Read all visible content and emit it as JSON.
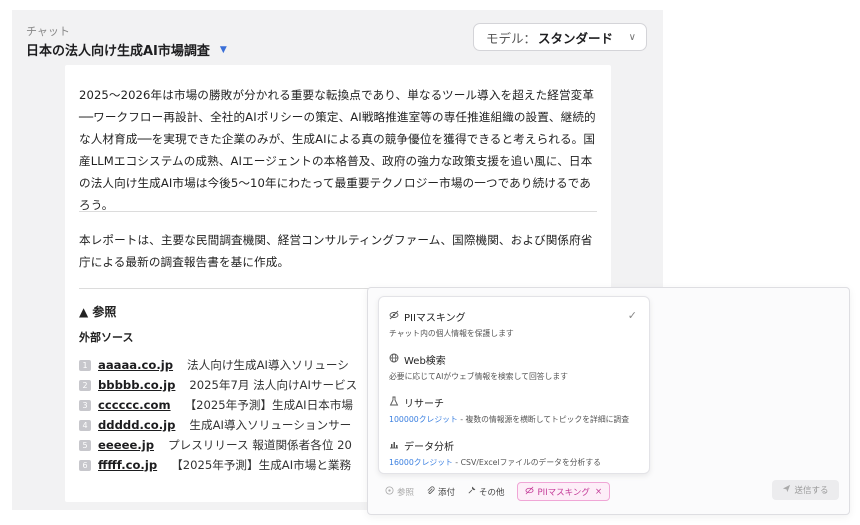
{
  "header": {
    "breadcrumb": "チャット",
    "title": "日本の法人向け生成AI市場調査",
    "title_caret": "▼"
  },
  "model_selector": {
    "label": "モデル：",
    "value": "スタンダード",
    "chevron": "∨"
  },
  "message": {
    "paragraphs": [
      "2025〜2026年は市場の勝敗が分かれる重要な転換点であり、単なるツール導入を超えた経営変革──ワークフロー再設計、全社的AIポリシーの策定、AI戦略推進室等の専任推進組織の設置、継続的な人材育成──を実現できた企業のみが、生成AIによる真の競争優位を獲得できると考えられる。国産LLMエコシステムの成熟、AIエージェントの本格普及、政府の強力な政策支援を追い風に、日本の法人向け生成AI市場は今後5〜10年にわたって最重要テクノロジー市場の一つであり続けるであろう。",
      "本レポートは、主要な民間調査機関、経営コンサルティングファーム、国際機関、および関係府省庁による最新の調査報告書を基に作成。"
    ],
    "references_heading": "▲ 参照",
    "external_sources_label": "外部ソース",
    "references": [
      {
        "num": "1",
        "domain": "aaaaa.co.jp",
        "desc": "法人向け生成AI導入ソリューシ"
      },
      {
        "num": "2",
        "domain": "bbbbb.co.jp",
        "desc": "2025年7月 法人向けAIサービス"
      },
      {
        "num": "3",
        "domain": "cccccc.com",
        "desc": "【2025年予測】生成AI日本市場"
      },
      {
        "num": "4",
        "domain": "ddddd.co.jp",
        "desc": "生成AI導入ソリューションサー"
      },
      {
        "num": "5",
        "domain": "eeeee.jp",
        "desc": "プレスリリース 報道関係者各位 20"
      },
      {
        "num": "6",
        "domain": "fffff.co.jp",
        "desc": "【2025年予測】生成AI市場と業務"
      }
    ]
  },
  "tools_menu": {
    "items": [
      {
        "icon": "eye-off-icon",
        "name": "PIIマスキング",
        "credit": "",
        "desc": "チャット内の個人情報を保護します",
        "checked": true
      },
      {
        "icon": "globe-icon",
        "name": "Web検索",
        "credit": "",
        "desc": "必要に応じてAIがウェブ情報を検索して回答します",
        "checked": false
      },
      {
        "icon": "flask-icon",
        "name": "リサーチ",
        "credit": "100000クレジット",
        "desc": " - 複数の情報源を横断してトピックを詳細に調査",
        "checked": false
      },
      {
        "icon": "bar-chart-icon",
        "name": "データ分析",
        "credit": "16000クレジット",
        "desc": " - CSV/Excelファイルのデータを分析する",
        "checked": false
      }
    ],
    "check_mark": "✓"
  },
  "composer": {
    "reference_label": "参照",
    "attach_label": "添付",
    "other_label": "その他",
    "pii_chip_label": "PIIマスキング",
    "pii_chip_close": "×",
    "send_label": "送信する"
  },
  "colors": {
    "accent_blue": "#3a7fe0",
    "pii_pink": "#c43c98",
    "panel_bg": "#f2f2f3"
  }
}
